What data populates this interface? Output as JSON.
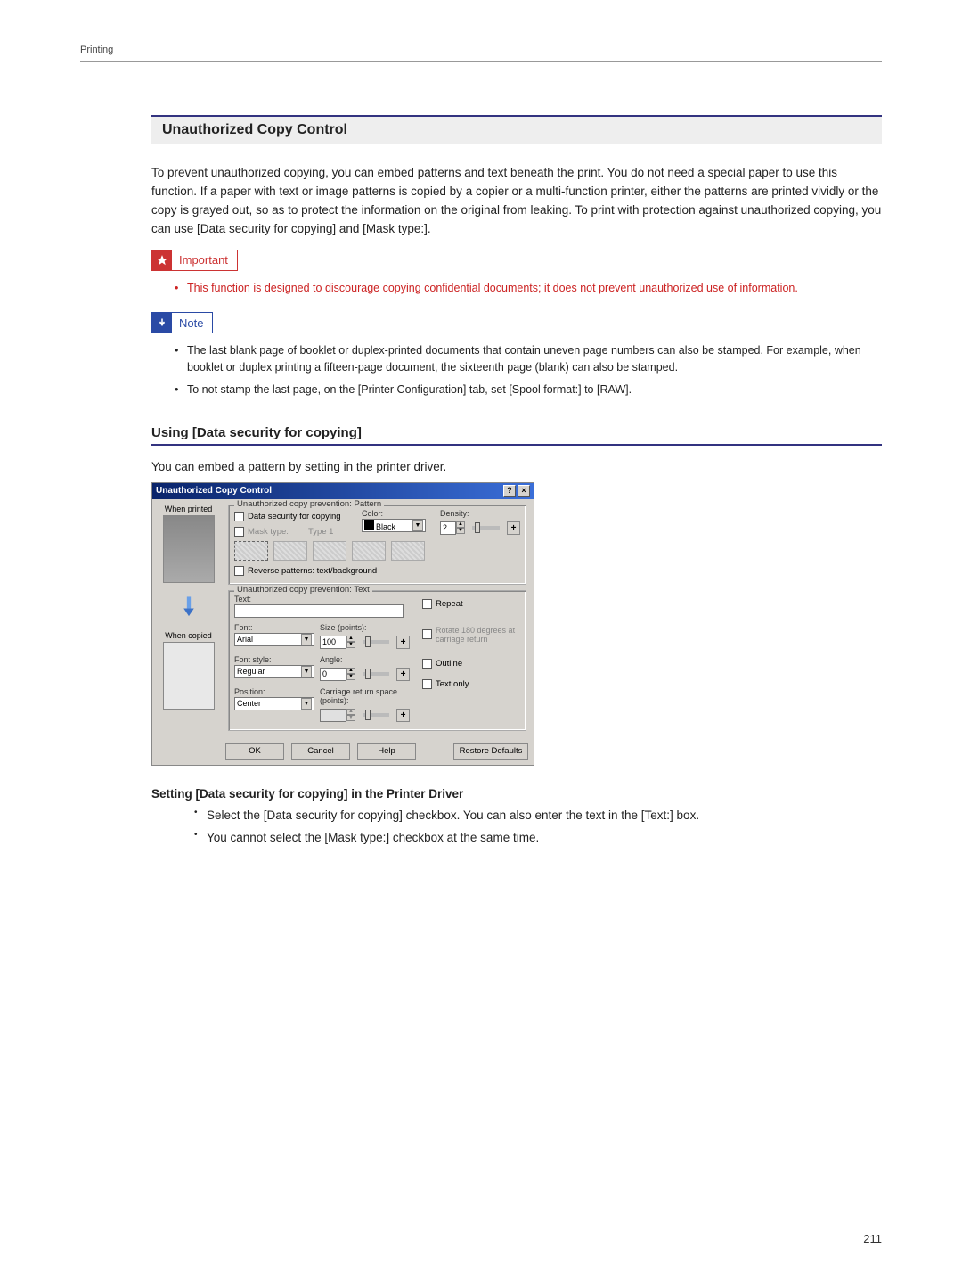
{
  "header": {
    "section": "Printing"
  },
  "page_number": "211",
  "section_heading": "Unauthorized Copy Control",
  "intro": "To prevent unauthorized copying, you can embed patterns and text beneath the print. You do not need a special paper to use this function. If a paper with text or image patterns is copied by a copier or a multi-function printer, either the patterns are printed vividly or the copy is grayed out, so as to protect the information on the original from leaking. To print with protection against unauthorized copying, you can use [Data security for copying] and [Mask type:].",
  "important_label": "Important",
  "important_bullets": [
    "This function is designed to discourage copying confidential documents; it does not prevent unauthorized use of information."
  ],
  "note_label": "Note",
  "note_bullets": [
    "The last blank page of booklet or duplex-printed documents that contain uneven page numbers can also be stamped. For example, when booklet or duplex printing a fifteen-page document, the sixteenth page (blank) can also be stamped.",
    "To not stamp the last page, on the [Printer Configuration] tab, set [Spool format:] to [RAW]."
  ],
  "subheading": "Using [Data security for copying]",
  "sub_intro": "You can embed a pattern by setting in the printer driver.",
  "dialog": {
    "title": "Unauthorized Copy Control",
    "left": {
      "printed": "When printed",
      "copied": "When copied"
    },
    "pattern_group": {
      "title": "Unauthorized copy prevention: Pattern",
      "data_security": "Data security for copying",
      "mask_type": "Mask type:",
      "mask_value": "Type 1",
      "color_label": "Color:",
      "color_value": "Black",
      "density_label": "Density:",
      "density_value": "2",
      "reverse": "Reverse patterns: text/background"
    },
    "text_group": {
      "title": "Unauthorized copy prevention: Text",
      "text_label": "Text:",
      "font_label": "Font:",
      "font_value": "Arial",
      "size_label": "Size (points):",
      "size_value": "100",
      "style_label": "Font style:",
      "style_value": "Regular",
      "angle_label": "Angle:",
      "angle_value": "0",
      "position_label": "Position:",
      "position_value": "Center",
      "carriage_label": "Carriage return space (points):",
      "repeat": "Repeat",
      "rotate": "Rotate 180 degrees at carriage return",
      "outline": "Outline",
      "text_only": "Text only"
    },
    "buttons": {
      "ok": "OK",
      "cancel": "Cancel",
      "help": "Help",
      "restore": "Restore Defaults"
    }
  },
  "setting_heading": "Setting [Data security for copying] in the Printer Driver",
  "setting_bullets": [
    "Select the [Data security for copying] checkbox. You can also enter the text in the [Text:] box.",
    "You cannot select the [Mask type:] checkbox at the same time."
  ]
}
